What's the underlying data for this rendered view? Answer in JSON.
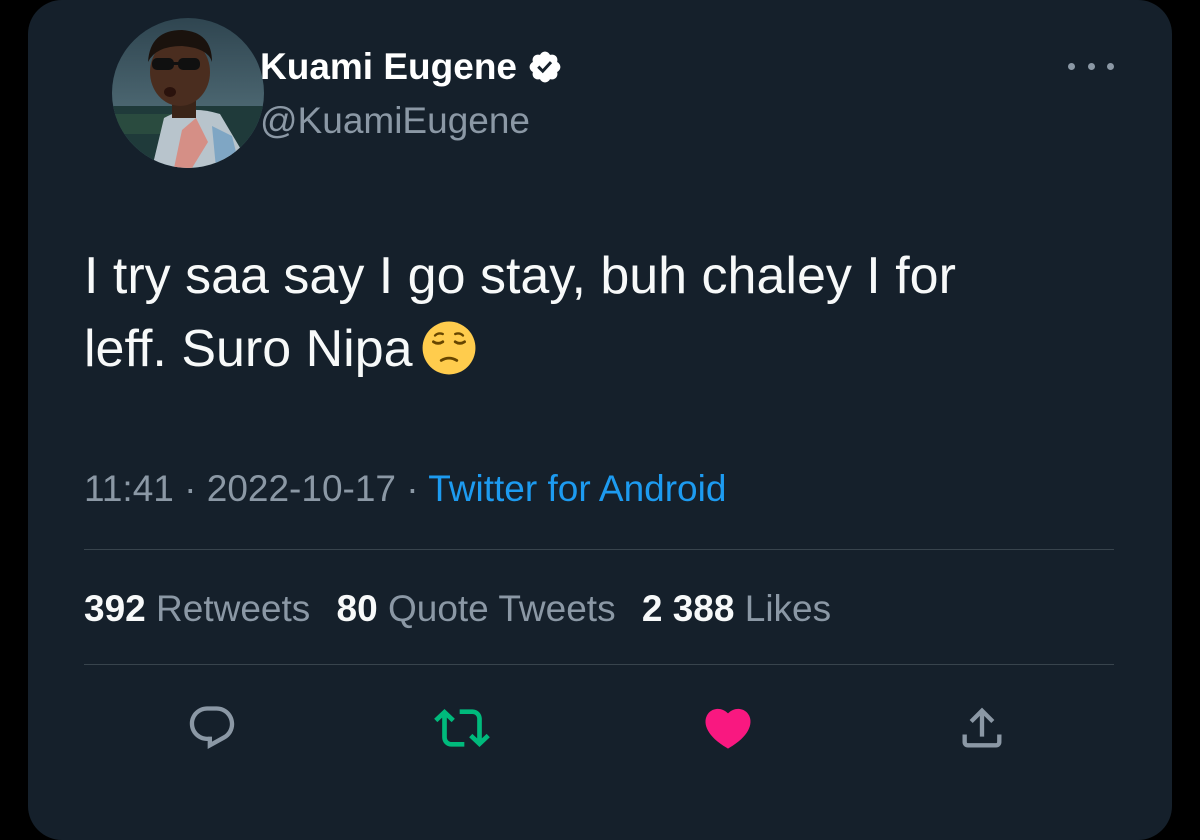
{
  "tweet": {
    "author": {
      "display_name": "Kuami Eugene",
      "handle": "@KuamiEugene",
      "verified": true
    },
    "text_line1": "I try saa say I go stay, buh chaley I for",
    "text_line2": "leff. Suro Nipa",
    "emoji": "pensive-face",
    "time": "11:41",
    "date": "2022-10-17",
    "separator": "·",
    "source": "Twitter for Android",
    "stats": {
      "retweets_count": "392",
      "retweets_label": "Retweets",
      "quotes_count": "80",
      "quotes_label": "Quote Tweets",
      "likes_count": "2 388",
      "likes_label": "Likes"
    },
    "liked": true,
    "retweeted": true
  },
  "icons": {
    "more": "more-horizontal-icon",
    "reply": "reply-icon",
    "retweet": "retweet-icon",
    "like": "heart-icon",
    "share": "share-icon",
    "verified": "verified-badge-icon"
  },
  "colors": {
    "background": "#15202b",
    "text": "#f7f9f9",
    "secondary": "#8b98a5",
    "link": "#1d9bf0",
    "retweet_active": "#00ba7c",
    "like_active": "#f91880",
    "divider": "#38444d"
  }
}
